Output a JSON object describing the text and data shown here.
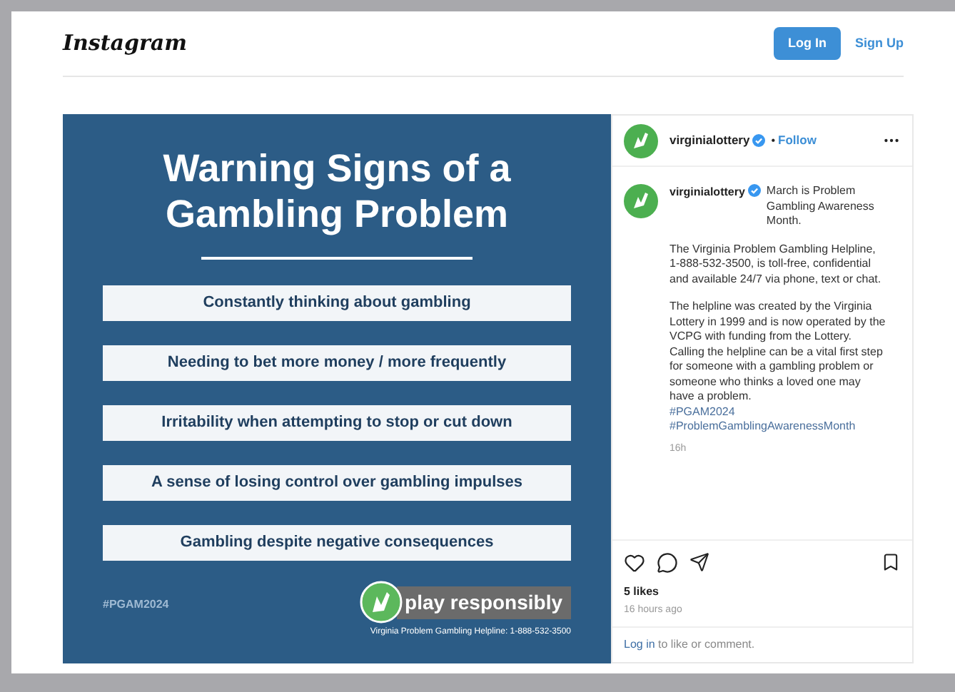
{
  "header": {
    "logo": "Instagram",
    "buttons": [
      {
        "label": "Log In",
        "kind": "primary"
      },
      {
        "label": "Sign Up",
        "kind": "link"
      }
    ]
  },
  "post": {
    "image": {
      "title": "Warning Signs of a Gambling Problem",
      "signs": [
        "Constantly thinking about gambling",
        "Needing to bet more money / more frequently",
        "Irritability when attempting to stop or cut down",
        "A sense of losing control over gambling impulses",
        "Gambling despite negative consequences"
      ],
      "hashtag": "#PGAM2024",
      "badge": "play responsibly",
      "helpline": "Virginia Problem Gambling Helpline: 1-888-532-3500"
    },
    "author": {
      "username": "virginialottery",
      "verified": true,
      "separator": "•",
      "follow": "Follow"
    },
    "caption": {
      "username": "virginialottery",
      "verified": true,
      "intro": "March is Problem Gambling Awareness Month.",
      "paragraphs": [
        "The Virginia Problem Gambling Helpline, 1-888-532-3500, is toll-free, confidential and available 24/7 via phone, text or chat.",
        "The helpline was created by the Virginia Lottery in 1999 and is now operated by the VCPG with funding from the Lottery. Calling the helpline can be a vital first step for someone with a gambling problem or someone who thinks a loved one may have a problem."
      ],
      "hashtags": [
        "#PGAM2024",
        "#ProblemGamblingAwarenessMonth"
      ],
      "time": "16h"
    },
    "likes": "5 likes",
    "posted": "16 hours ago",
    "login_prompt": {
      "link": "Log in",
      "text": "to like or comment."
    }
  }
}
